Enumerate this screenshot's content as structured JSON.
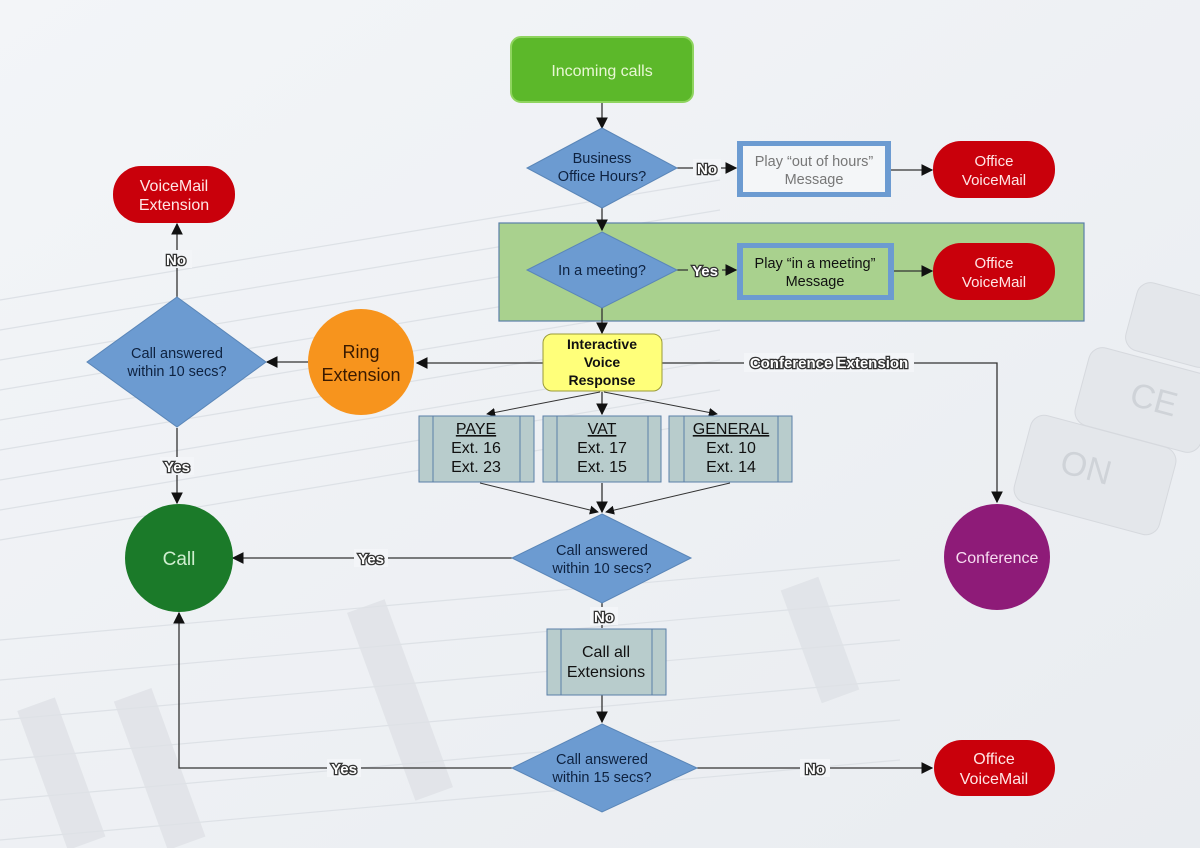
{
  "colors": {
    "start": "#5cb82a",
    "decision": "#6c9bd1",
    "process_blue_border": "#6c9bd1",
    "terminal_red": "#c9000b",
    "ring_orange": "#f7941d",
    "call_green": "#1b7a29",
    "conference_purple": "#8e1b78",
    "ivr_yellow": "#ffff7a",
    "extension_box": "#b8cccc",
    "meeting_panel": "#a9d18e"
  },
  "nodes": {
    "incoming": "Incoming calls",
    "business_hours": [
      "Business",
      "Office Hours?"
    ],
    "out_of_hours_msg": [
      "Play “out of hours”",
      "Message"
    ],
    "office_voicemail_1": [
      "Office",
      "VoiceMail"
    ],
    "in_meeting": "In a meeting?",
    "meeting_msg": [
      "Play “in a meeting”",
      "Message"
    ],
    "office_voicemail_2": [
      "Office",
      "VoiceMail"
    ],
    "ivr": [
      "Interactive",
      "Voice",
      "Response"
    ],
    "ring_extension": [
      "Ring",
      "Extension"
    ],
    "answered_10_left": [
      "Call answered",
      "within 10 secs?"
    ],
    "voicemail_extension": [
      "VoiceMail",
      "Extension"
    ],
    "call": "Call",
    "paye": {
      "title": "PAYE",
      "lines": [
        "Ext. 16",
        "Ext. 23"
      ]
    },
    "vat": {
      "title": "VAT",
      "lines": [
        "Ext. 17",
        "Ext. 15"
      ]
    },
    "general": {
      "title": "GENERAL",
      "lines": [
        "Ext. 10",
        "Ext. 14"
      ]
    },
    "answered_10_center": [
      "Call answered",
      "within 10 secs?"
    ],
    "call_all": [
      "Call all",
      "Extensions"
    ],
    "answered_15": [
      "Call answered",
      "within 15 secs?"
    ],
    "office_voicemail_3": [
      "Office",
      "VoiceMail"
    ],
    "conference": "Conference"
  },
  "edge_labels": {
    "hours_no": "No",
    "meeting_yes": "Yes",
    "conference_ext": "Conference Extension",
    "left_no": "No",
    "left_yes": "Yes",
    "center_yes": "Yes",
    "center_no": "No",
    "bottom_yes": "Yes",
    "bottom_no": "No"
  }
}
